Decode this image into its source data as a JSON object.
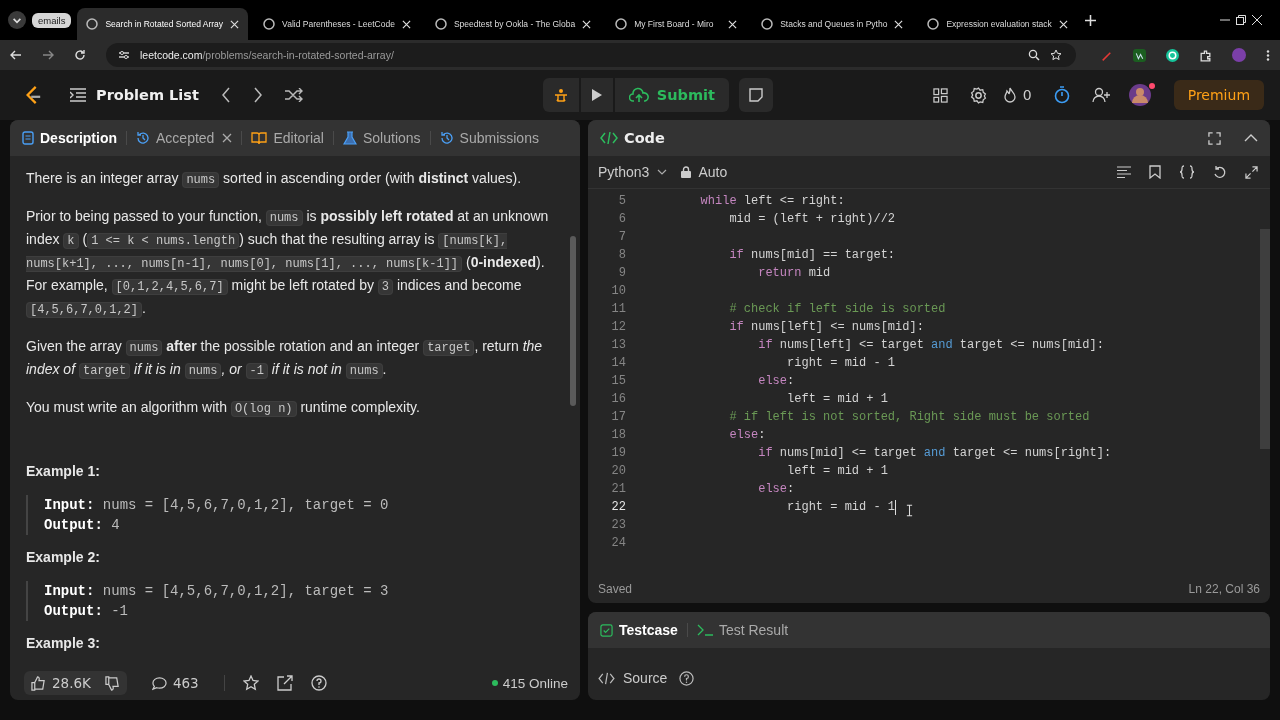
{
  "browser": {
    "group": "emails",
    "tabs": [
      {
        "title": "Search in Rotated Sorted Array",
        "selected": true
      },
      {
        "title": "Valid Parentheses - LeetCode",
        "selected": false
      },
      {
        "title": "Speedtest by Ookla - The Globa",
        "selected": false
      },
      {
        "title": "My First Board - Miro",
        "selected": false
      },
      {
        "title": "Stacks and Queues in Pytho",
        "selected": false
      },
      {
        "title": "Expression evaluation stack",
        "selected": false
      }
    ],
    "url_host": "leetcode.com",
    "url_path": "/problems/search-in-rotated-sorted-array/"
  },
  "nav": {
    "problem_list": "Problem List",
    "submit": "Submit",
    "streak": "0",
    "premium": "Premium"
  },
  "left_tabs": [
    {
      "label": "Description",
      "selected": true,
      "closable": false
    },
    {
      "label": "Accepted",
      "selected": false,
      "closable": true
    },
    {
      "label": "Editorial",
      "selected": false,
      "closable": false
    },
    {
      "label": "Solutions",
      "selected": false,
      "closable": false
    },
    {
      "label": "Submissions",
      "selected": false,
      "closable": false
    }
  ],
  "paragraphs": [
    [
      {
        "kind": "text",
        "text": "There is an integer array "
      },
      {
        "kind": "code",
        "text": "nums"
      },
      {
        "kind": "text",
        "text": " sorted in ascending order (with **distinct** values)."
      }
    ],
    [
      {
        "kind": "text",
        "text": "Prior to being passed to your function, "
      },
      {
        "kind": "code",
        "text": "nums"
      },
      {
        "kind": "text",
        "text": " is **possibly left rotated** at an unknown index "
      },
      {
        "kind": "code",
        "text": "k"
      },
      {
        "kind": "text",
        "text": " ("
      },
      {
        "kind": "code",
        "text": "1 <= k < nums.length"
      },
      {
        "kind": "text",
        "text": ") such that the resulting array is "
      },
      {
        "kind": "code",
        "text": "[nums[k], nums[k+1], ..., nums[n-1], nums[0], nums[1], ..., nums[k-1]]"
      },
      {
        "kind": "text",
        "text": " (**0-indexed**). For example, "
      },
      {
        "kind": "code",
        "text": "[0,1,2,4,5,6,7]"
      },
      {
        "kind": "text",
        "text": " might be left rotated by "
      },
      {
        "kind": "code",
        "text": "3"
      },
      {
        "kind": "text",
        "text": " indices and become "
      },
      {
        "kind": "code",
        "text": "[4,5,6,7,0,1,2]"
      },
      {
        "kind": "text",
        "text": "."
      }
    ],
    [
      {
        "kind": "text",
        "text": "Given the array "
      },
      {
        "kind": "code",
        "text": "nums"
      },
      {
        "kind": "text",
        "text": " **after** the possible rotation and an integer "
      },
      {
        "kind": "code",
        "text": "target"
      },
      {
        "kind": "text",
        "text": ", return *the index of* "
      },
      {
        "kind": "code",
        "text": "target"
      },
      {
        "kind": "text",
        "text": " *if it is in* "
      },
      {
        "kind": "code",
        "text": "nums"
      },
      {
        "kind": "text",
        "text": "*, or* "
      },
      {
        "kind": "code",
        "text": "-1"
      },
      {
        "kind": "text",
        "text": " *if it is not in* "
      },
      {
        "kind": "code",
        "text": "nums"
      },
      {
        "kind": "text",
        "text": "."
      }
    ],
    [
      {
        "kind": "text",
        "text": "You must write an algorithm with "
      },
      {
        "kind": "code",
        "text": "O(log n)"
      },
      {
        "kind": "text",
        "text": " runtime complexity."
      }
    ]
  ],
  "examples": [
    {
      "title": "Example 1:",
      "input_label": "Input:",
      "input": "nums = [4,5,6,7,0,1,2], target = 0",
      "output_label": "Output:",
      "output": "4"
    },
    {
      "title": "Example 2:",
      "input_label": "Input:",
      "input": "nums = [4,5,6,7,0,1,2], target = 3",
      "output_label": "Output:",
      "output": "-1"
    },
    {
      "title": "Example 3:"
    }
  ],
  "footer": {
    "likes": "28.6K",
    "comments": "463",
    "online": "415 Online"
  },
  "code_panel": {
    "title": "Code",
    "language": "Python3",
    "mode": "Auto",
    "status": "Saved",
    "position": "Ln 22, Col 36",
    "lines": [
      {
        "n": "5",
        "current": false,
        "tokens": [
          {
            "kind": "kw",
            "t": "        while"
          },
          {
            "kind": "plain",
            "t": " left <= right:"
          }
        ]
      },
      {
        "n": "6",
        "current": false,
        "tokens": [
          {
            "kind": "plain",
            "t": "            mid = (left + right)//2"
          }
        ]
      },
      {
        "n": "7",
        "current": false
      },
      {
        "n": "8",
        "current": false,
        "tokens": [
          {
            "kind": "kw",
            "t": "            if"
          },
          {
            "kind": "plain",
            "t": " nums[mid] == target:"
          }
        ]
      },
      {
        "n": "9",
        "current": false,
        "tokens": [
          {
            "kind": "kw",
            "t": "                return"
          },
          {
            "kind": "plain",
            "t": " mid"
          }
        ]
      },
      {
        "n": "10",
        "current": false
      },
      {
        "n": "11",
        "current": false,
        "tokens": [
          {
            "kind": "comment",
            "t": "            # check if left side is sorted"
          }
        ]
      },
      {
        "n": "12",
        "current": false,
        "tokens": [
          {
            "kind": "kw",
            "t": "            if"
          },
          {
            "kind": "plain",
            "t": " nums[left] <= nums[mid]:"
          }
        ]
      },
      {
        "n": "13",
        "current": false,
        "tokens": [
          {
            "kind": "kw",
            "t": "                if"
          },
          {
            "kind": "plain",
            "t": " nums[left] <= target "
          },
          {
            "kind": "op",
            "t": "and"
          },
          {
            "kind": "plain",
            "t": " target <= nums[mid]:"
          }
        ]
      },
      {
        "n": "14",
        "current": false,
        "tokens": [
          {
            "kind": "plain",
            "t": "                    right = mid - 1"
          }
        ]
      },
      {
        "n": "15",
        "current": false,
        "tokens": [
          {
            "kind": "kw",
            "t": "                else"
          },
          {
            "kind": "plain",
            "t": ":"
          }
        ]
      },
      {
        "n": "16",
        "current": false,
        "tokens": [
          {
            "kind": "plain",
            "t": "                    left = mid + 1"
          }
        ]
      },
      {
        "n": "17",
        "current": false,
        "tokens": [
          {
            "kind": "comment",
            "t": "            # if left is not sorted, Right side must be sorted"
          }
        ]
      },
      {
        "n": "18",
        "current": false,
        "tokens": [
          {
            "kind": "kw",
            "t": "            else"
          },
          {
            "kind": "plain",
            "t": ":"
          }
        ]
      },
      {
        "n": "19",
        "current": false,
        "tokens": [
          {
            "kind": "kw",
            "t": "                if"
          },
          {
            "kind": "plain",
            "t": " nums[mid] <= target "
          },
          {
            "kind": "op",
            "t": "and"
          },
          {
            "kind": "plain",
            "t": " target <= nums[right]:"
          }
        ]
      },
      {
        "n": "20",
        "current": false,
        "tokens": [
          {
            "kind": "plain",
            "t": "                    left = mid + 1"
          }
        ]
      },
      {
        "n": "21",
        "current": false,
        "tokens": [
          {
            "kind": "kw",
            "t": "                else"
          },
          {
            "kind": "plain",
            "t": ":"
          }
        ]
      },
      {
        "n": "22",
        "current": true,
        "tokens": [
          {
            "kind": "plain",
            "t": "                    right = mid - 1"
          }
        ]
      },
      {
        "n": "23",
        "current": false
      },
      {
        "n": "24",
        "current": false
      }
    ]
  },
  "test_panel": {
    "tabs": [
      {
        "label": "Testcase",
        "selected": true
      },
      {
        "label": "Test Result",
        "selected": false
      }
    ],
    "source": "Source"
  }
}
